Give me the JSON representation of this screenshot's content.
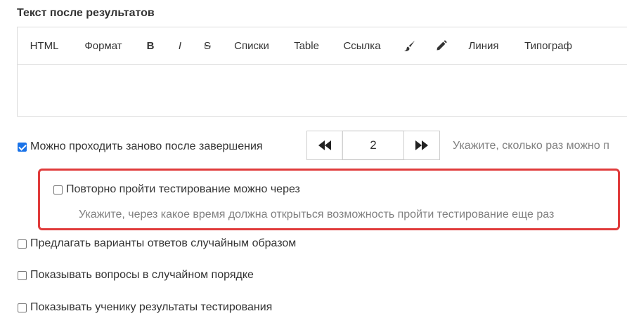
{
  "section": {
    "title": "Текст после результатов"
  },
  "toolbar": {
    "items": [
      {
        "label": "HTML"
      },
      {
        "label": "Формат"
      },
      {
        "label": "B"
      },
      {
        "label": "I"
      },
      {
        "label": "S"
      },
      {
        "label": "Списки"
      },
      {
        "label": "Table"
      },
      {
        "label": "Ссылка"
      },
      {
        "icon": "brush-icon"
      },
      {
        "icon": "pencil-icon"
      },
      {
        "label": "Линия"
      },
      {
        "label": "Типограф"
      }
    ]
  },
  "retake": {
    "label": "Можно проходить заново после завершения",
    "checked": true,
    "count_value": "2",
    "hint": "Укажите, сколько раз можно п"
  },
  "retake_delay": {
    "label": "Повторно пройти тестирование можно через",
    "checked": false,
    "hint": "Укажите, через какое время должна открыться возможность пройти тестирование еще раз"
  },
  "options": [
    {
      "label": "Предлагать варианты ответов случайным образом",
      "checked": false
    },
    {
      "label": "Показывать вопросы в случайном порядке",
      "checked": false
    },
    {
      "label": "Показывать ученику результаты тестирования",
      "checked": false
    }
  ],
  "colors": {
    "accent": "#1a73e8",
    "highlight": "#e03b3b",
    "hint": "#808080"
  }
}
